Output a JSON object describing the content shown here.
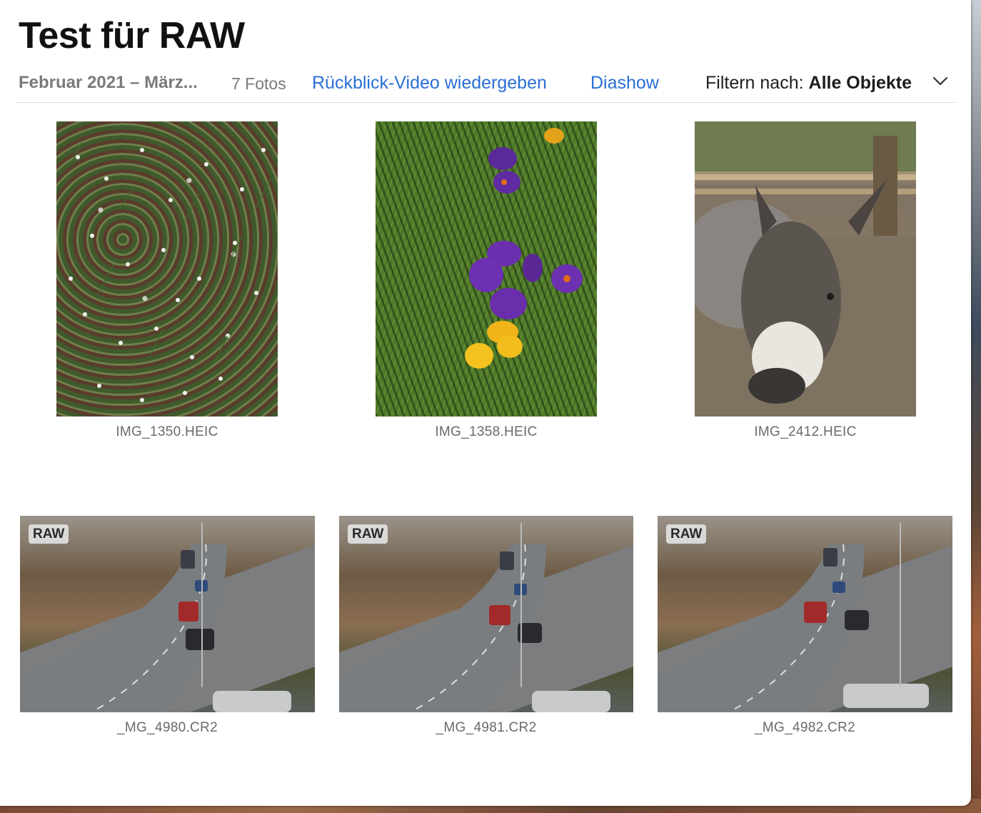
{
  "album": {
    "title": "Test für RAW",
    "date_range": "Februar 2021 – März...",
    "photo_count": "7 Fotos",
    "memory_video_label": "Rückblick-Video wiedergeben",
    "slideshow_label": "Diashow",
    "filter_prefix": "Filtern nach:",
    "filter_value": "Alle Objekte",
    "filter_icon": "chevron-down-icon"
  },
  "photos": [
    {
      "filename": "IMG_1350.HEIC",
      "raw": false
    },
    {
      "filename": "IMG_1358.HEIC",
      "raw": false
    },
    {
      "filename": "IMG_2412.HEIC",
      "raw": false
    },
    {
      "filename": "_MG_4980.CR2",
      "raw": true,
      "badge": "RAW"
    },
    {
      "filename": "_MG_4981.CR2",
      "raw": true,
      "badge": "RAW"
    },
    {
      "filename": "_MG_4982.CR2",
      "raw": true,
      "badge": "RAW"
    }
  ],
  "colors": {
    "link": "#2a6fd6",
    "secondary_text": "#7a7a7a"
  }
}
